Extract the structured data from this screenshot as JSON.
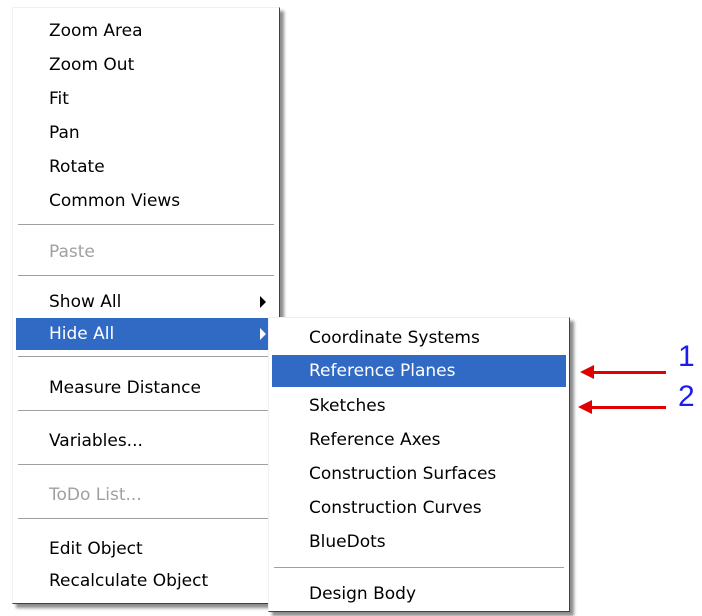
{
  "main_menu": {
    "items": [
      {
        "label": "Zoom Area"
      },
      {
        "label": "Zoom Out"
      },
      {
        "label": "Fit"
      },
      {
        "label": "Pan"
      },
      {
        "label": "Rotate"
      },
      {
        "label": "Common Views"
      },
      {
        "label": "Paste",
        "disabled": true
      },
      {
        "label": "Show All",
        "submenu": true
      },
      {
        "label": "Hide All",
        "submenu": true,
        "selected": true
      },
      {
        "label": "Measure Distance"
      },
      {
        "label": "Variables..."
      },
      {
        "label": "ToDo List...",
        "disabled": true
      },
      {
        "label": "Edit Object"
      },
      {
        "label": "Recalculate Object"
      }
    ]
  },
  "sub_menu": {
    "items": [
      {
        "label": "Coordinate Systems"
      },
      {
        "label": "Reference Planes",
        "selected": true
      },
      {
        "label": "Sketches"
      },
      {
        "label": "Reference Axes"
      },
      {
        "label": "Construction Surfaces"
      },
      {
        "label": "Construction Curves"
      },
      {
        "label": "BlueDots"
      },
      {
        "label": "Design Body"
      }
    ]
  },
  "callouts": [
    {
      "number": "1"
    },
    {
      "number": "2"
    }
  ],
  "colors": {
    "selection": "#316ac5",
    "arrow": "#e00000",
    "callout_text": "#1c1cf0",
    "disabled_text": "#a0a0a0"
  }
}
